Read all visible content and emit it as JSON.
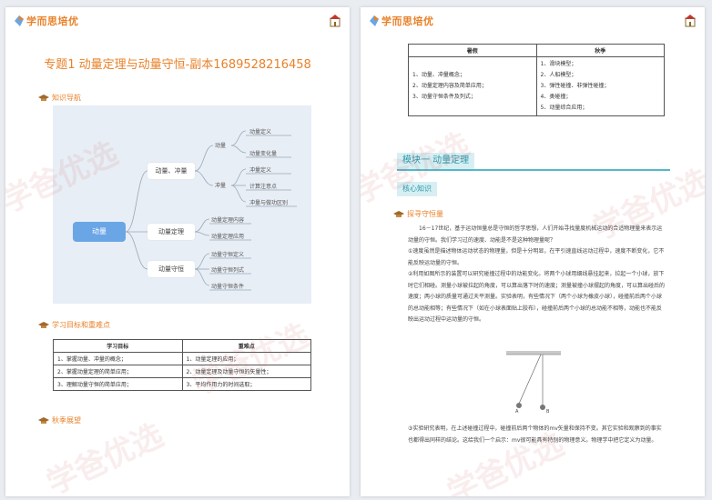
{
  "brand": {
    "name": "学而思培优",
    "color": "#e8822a"
  },
  "left_page": {
    "title": "专题1 动量定理与动量守恒-副本1689528216458",
    "sections": {
      "nav": "知识导航",
      "goals": "学习目标和重难点",
      "expand": "秋季展望"
    },
    "mindmap": {
      "root": "动量",
      "branches": [
        {
          "label": "动量、冲量",
          "groups": [
            {
              "label": "动量",
              "items": [
                "动量定义",
                "动量变化量"
              ]
            },
            {
              "label": "冲量",
              "items": [
                "冲量定义",
                "计算注意点",
                "冲量与做功区别"
              ]
            }
          ]
        },
        {
          "label": "动量定理",
          "items": [
            "动量定理内容",
            "动量定理应用"
          ]
        },
        {
          "label": "动量守恒",
          "items": [
            "动量守恒定义",
            "动量守恒列式",
            "动量守恒条件"
          ]
        }
      ]
    },
    "goals_table": {
      "headers": [
        "学习目标",
        "重难点"
      ],
      "rows": [
        [
          "1、掌握动量、冲量的概念；",
          "1、动量定理的应用；"
        ],
        [
          "2、掌握动量定理的简单应用；",
          "2、动量定理及动量守恒的矢量性；"
        ],
        [
          "3、理解动量守恒的简单应用；",
          "3、平均作用力的时间选取；"
        ]
      ]
    }
  },
  "right_page": {
    "compare_table": {
      "headers": [
        "暑假",
        "秋季"
      ],
      "summer": [
        "1、动量、冲量概念；",
        "2、动量定理内容及简单应用；",
        "3、动量守恒条件及列式；"
      ],
      "autumn": [
        "1、滑块模型；",
        "2、人船模型；",
        "3、弹性碰撞、非弹性碰撞；",
        "4、类碰撞；",
        "5、动量综合应用；"
      ]
    },
    "module_title": "模块一 动量定理",
    "core_tab": "核心知识",
    "explore_heading": "探寻守恒量",
    "paragraphs": [
      "16－17世纪，基于运动恒量总是守恒的哲学思想，人们开始寻找量度机械运动的合适物理量来表示运动量的守恒。我们学习过的速度、动能是不是这种物理量呢？",
      "①速度虽然是描述物体运动状态的物理量，但是十分明显，在平引速直线运动过程中，速度不断变化，它不能反映运动量的守恒。",
      "②利用如图所示的装置可以研究碰撞过程中的动能变化。将两个小球用细线悬挂起来，拉起一个小球，放下时它们相碰。测量小球被拉起的角度，可以算出落下时的速度；测量被撞小球摆起的角度，可以算出碰后的速度；两小球的质量可通过天平测量。实验表明，有些情况下（两个小球为橡皮小球），碰撞前后两个小球的总动能相等；有些情况下（如在小球表面贴上胶布），碰撞前后两个小球的总动能不相等，动能也不能反映出运动过程中运动量的守恒。",
      "③实验研究表明，在上述碰撞过程中，碰撞前后两个物体的mv矢量和保持不变。其它实验和观察到的事实也都得出同样的结论。这给我们一个启示：mv很可能具有特别的物理意义。物理学中把它定义为动量。"
    ],
    "figure_labels": {
      "ball_a": "A",
      "ball_b": "B"
    }
  },
  "watermark": "学爸优选"
}
